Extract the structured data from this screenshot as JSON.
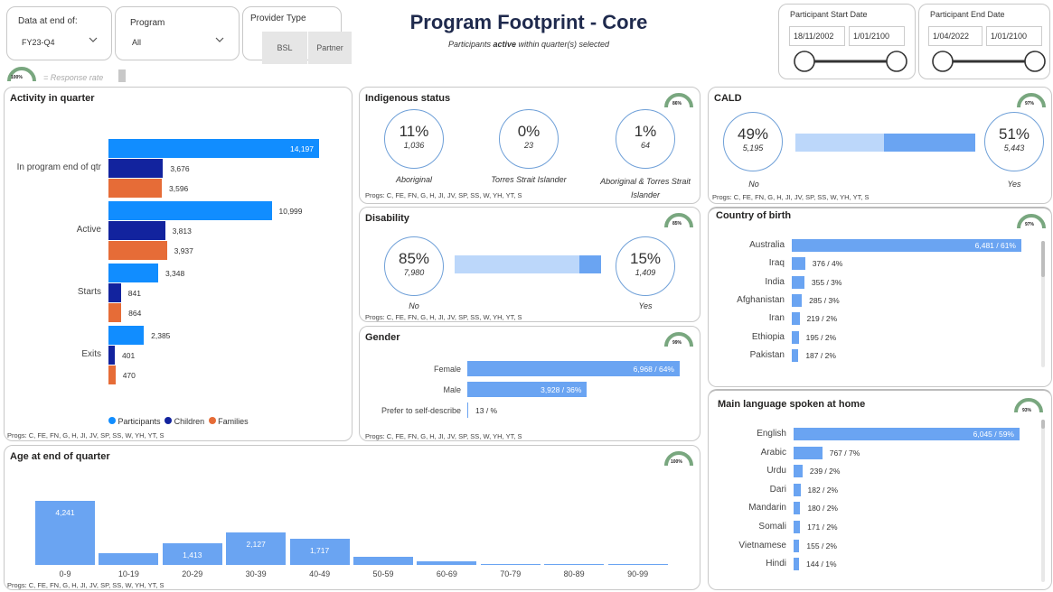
{
  "title": "Program Footprint - Core",
  "subtitle": {
    "pre": "Participants ",
    "em": "active",
    "post": " within quarter(s) selected"
  },
  "filters": {
    "data_at_end": {
      "label": "Data at end of:",
      "value": "FY23-Q4"
    },
    "program": {
      "label": "Program",
      "value": "All"
    },
    "provider_type": {
      "label": "Provider Type",
      "options": [
        "BSL",
        "Partner"
      ]
    },
    "start_date": {
      "label": "Participant Start Date",
      "from": "18/11/2002",
      "to": "1/01/2100"
    },
    "end_date": {
      "label": "Participant End Date",
      "from": "1/04/2022",
      "to": "1/01/2100"
    }
  },
  "response_legend": {
    "badge": "100%",
    "text": "= Response rate"
  },
  "colors": {
    "participants": "#118dff",
    "children": "#12239e",
    "families": "#e66c37",
    "bar": "#6aa4f2",
    "gauge": "#79a77f"
  },
  "activity": {
    "title": "Activity in quarter",
    "gauge": "",
    "progs": "Progs: C, FE, FN, G, H, JI, JV, SP, SS, W, YH, YT, S",
    "legend": [
      "Participants",
      "Children",
      "Families"
    ],
    "chart_data": {
      "type": "bar",
      "categories": [
        "In program end of qtr",
        "Active",
        "Starts",
        "Exits"
      ],
      "series": [
        {
          "name": "Participants",
          "values": [
            14197,
            10999,
            3348,
            2385
          ]
        },
        {
          "name": "Children",
          "values": [
            3676,
            3813,
            841,
            401
          ]
        },
        {
          "name": "Families",
          "values": [
            3596,
            3937,
            864,
            470
          ]
        }
      ],
      "labels": [
        [
          "14,197",
          "3,676",
          "3,596"
        ],
        [
          "10,999",
          "3,813",
          "3,937"
        ],
        [
          "3,348",
          "841",
          "864"
        ],
        [
          "2,385",
          "401",
          "470"
        ]
      ]
    }
  },
  "indigenous": {
    "title": "Indigenous status",
    "gauge": "86%",
    "items": [
      {
        "pct": "11%",
        "num": "1,036",
        "label": "Aboriginal"
      },
      {
        "pct": "0%",
        "num": "23",
        "label": "Torres Strait Islander"
      },
      {
        "pct": "1%",
        "num": "64",
        "label": "Aboriginal & Torres Strait Islander"
      }
    ],
    "progs": "Progs: C, FE, FN, G, H, JI, JV, SP, SS, W, YH, YT, S"
  },
  "disability": {
    "title": "Disability",
    "gauge": "85%",
    "no": {
      "pct": "85%",
      "num": "7,980",
      "label": "No"
    },
    "yes": {
      "pct": "15%",
      "num": "1,409",
      "label": "Yes"
    },
    "yes_fraction": 0.15,
    "progs": "Progs: C, FE, FN, G, H, JI, JV, SP, SS, W, YH, YT, S"
  },
  "gender": {
    "title": "Gender",
    "gauge": "99%",
    "chart_data": {
      "type": "bar",
      "categories": [
        "Female",
        "Male",
        "Prefer to self-describe"
      ],
      "values": [
        6968,
        3928,
        13
      ],
      "labels": [
        "6,968 / 64%",
        "3,928 / 36%",
        "13 / %"
      ]
    },
    "progs": "Progs: C, FE, FN, G, H, JI, JV, SP, SS, W, YH, YT, S"
  },
  "cald": {
    "title": "CALD",
    "gauge": "97%",
    "no": {
      "pct": "49%",
      "num": "5,195",
      "label": "No"
    },
    "yes": {
      "pct": "51%",
      "num": "5,443",
      "label": "Yes"
    },
    "yes_fraction": 0.51,
    "progs": "Progs: C, FE, FN, G, H, JI, JV, SP, SS, W, YH, YT, S"
  },
  "country": {
    "title": "Country of birth",
    "gauge": "97%",
    "chart_data": {
      "type": "bar",
      "categories": [
        "Australia",
        "Iraq",
        "India",
        "Afghanistan",
        "Iran",
        "Ethiopia",
        "Pakistan"
      ],
      "values": [
        6481,
        376,
        355,
        285,
        219,
        195,
        187
      ],
      "labels": [
        "6,481 / 61%",
        "376 / 4%",
        "355 / 3%",
        "285 / 3%",
        "219 / 2%",
        "195 / 2%",
        "187 / 2%"
      ]
    }
  },
  "language": {
    "title": "Main language spoken at home",
    "gauge": "93%",
    "chart_data": {
      "type": "bar",
      "categories": [
        "English",
        "Arabic",
        "Urdu",
        "Dari",
        "Mandarin",
        "Somali",
        "Vietnamese",
        "Hindi"
      ],
      "values": [
        6045,
        767,
        239,
        182,
        180,
        171,
        155,
        144
      ],
      "labels": [
        "6,045 / 59%",
        "767 / 7%",
        "239 / 2%",
        "182 / 2%",
        "180 / 2%",
        "171 / 2%",
        "155 / 2%",
        "144 / 1%"
      ]
    }
  },
  "age": {
    "title": "Age at end of quarter",
    "gauge": "100%",
    "chart_data": {
      "type": "bar",
      "categories": [
        "0-9",
        "10-19",
        "20-29",
        "30-39",
        "40-49",
        "50-59",
        "60-69",
        "70-79",
        "80-89",
        "90-99"
      ],
      "values": [
        4241,
        790,
        1413,
        2127,
        1717,
        560,
        240,
        80,
        40,
        5
      ],
      "labels": [
        "4,241",
        "",
        "1,413",
        "2,127",
        "1,717",
        "",
        "",
        "",
        "",
        ""
      ]
    },
    "progs": "Progs: C, FE, FN, G, H, JI, JV, SP, SS, W, YH, YT, S"
  }
}
